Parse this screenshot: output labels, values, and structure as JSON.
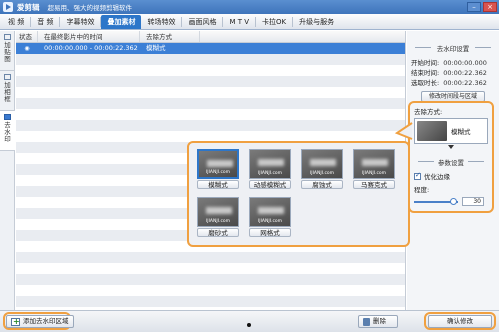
{
  "window": {
    "app_name": "爱剪辑",
    "slogan": "超易用、强大的视频剪辑软件",
    "controls": [
      "–",
      "×"
    ]
  },
  "tabs": [
    {
      "label": "视  频",
      "active": false
    },
    {
      "label": "音  频",
      "active": false
    },
    {
      "label": "字幕特效",
      "active": false
    },
    {
      "label": "叠加素材",
      "active": true
    },
    {
      "label": "转场特效",
      "active": false
    },
    {
      "label": "画面风格",
      "active": false
    },
    {
      "label": "M T V",
      "active": false
    },
    {
      "label": "卡拉OK",
      "active": false
    },
    {
      "label": "升级与服务",
      "active": false
    }
  ],
  "side_tabs": [
    {
      "label": "加\n贴\n图",
      "active": false
    },
    {
      "label": "加\n相\n框",
      "active": false
    },
    {
      "label": "去\n水\n印",
      "active": true
    }
  ],
  "list": {
    "headers": [
      "状态",
      "在最终影片中的时间",
      "去除方式"
    ],
    "rows": [
      {
        "status": "◉",
        "time": "00:00:00.000 - 00:00:22.362",
        "method": "模糊式",
        "selected": true
      }
    ]
  },
  "right_panel": {
    "section_title": "去水印设置",
    "start_label": "开始时间:",
    "start_value": "00:00:00.000",
    "end_label": "结束时间:",
    "end_value": "00:00:22.362",
    "dur_label": "选取时长:",
    "dur_value": "00:00:22.362",
    "modify_button": "修改时间段与区域",
    "method_label": "去除方式:",
    "method_value": "模糊式",
    "param_title": "参数设置",
    "optimize_label": "优化边缘",
    "optimize_checked": true,
    "degree_label": "程度:",
    "degree_value": "30",
    "degree_fraction": 0.9
  },
  "popup": {
    "watermark_text": "IJIANJI.com",
    "items": [
      {
        "label": "模糊式",
        "selected": true
      },
      {
        "label": "动感模糊式",
        "selected": false
      },
      {
        "label": "腐蚀式",
        "selected": false
      },
      {
        "label": "马赛克式",
        "selected": false
      },
      {
        "label": "磨砂式",
        "selected": false
      },
      {
        "label": "网格式",
        "selected": false
      }
    ]
  },
  "bottom": {
    "add_button": "添加去水印区域",
    "delete_button": "删除",
    "confirm_button": "确认修改"
  },
  "colors": {
    "accent": "#2d76c9",
    "highlight": "#f0a040"
  }
}
